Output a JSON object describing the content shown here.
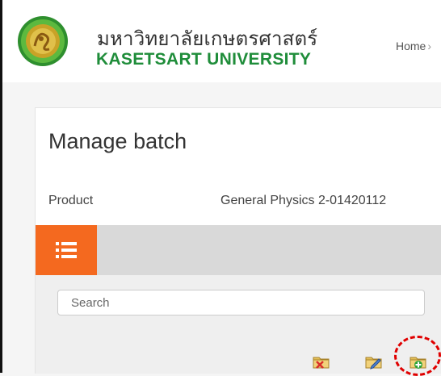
{
  "header": {
    "university_thai": "มหาวิทยาลัยเกษตรศาสตร์",
    "university_en": "KASETSART UNIVERSITY",
    "breadcrumb": {
      "home_label": "Home",
      "separator": "›"
    }
  },
  "page": {
    "title": "Manage batch",
    "product_label": "Product",
    "product_value": "General Physics 2-01420112"
  },
  "toolbar": {
    "menu_icon": "list-icon",
    "accent_color": "#f4691f"
  },
  "search": {
    "placeholder": "Search"
  },
  "actions": [
    {
      "icon": "folder-delete-icon"
    },
    {
      "icon": "folder-edit-icon"
    },
    {
      "icon": "folder-add-icon",
      "highlighted": true
    }
  ]
}
